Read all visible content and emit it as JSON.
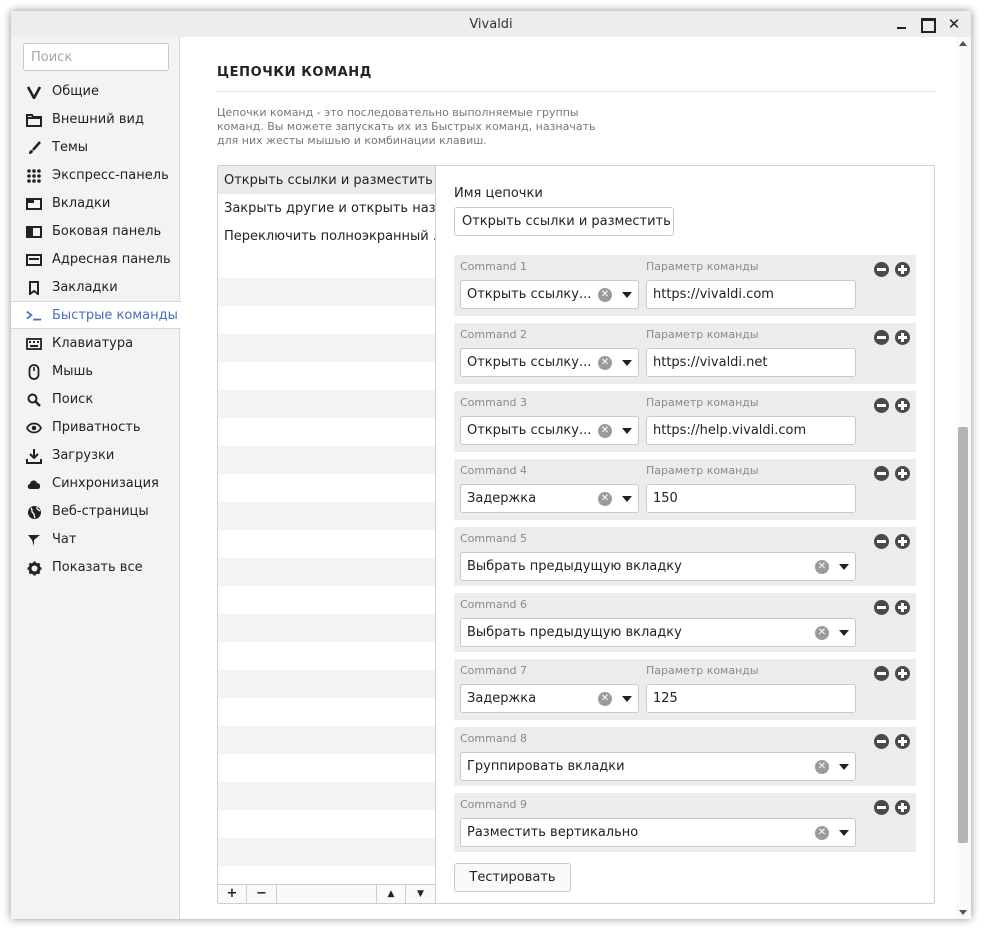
{
  "window": {
    "title": "Vivaldi"
  },
  "colors": {
    "accent": "#4a6fc0",
    "panel_bg": "#ececec",
    "sidebar_bg": "#f3f3f3"
  },
  "sidebar": {
    "search_placeholder": "Поиск",
    "items": [
      {
        "label": "Общие",
        "icon": "vivaldi-logo-icon"
      },
      {
        "label": "Внешний вид",
        "icon": "folder-icon"
      },
      {
        "label": "Темы",
        "icon": "brush-icon"
      },
      {
        "label": "Экспресс-панель",
        "icon": "grid-icon"
      },
      {
        "label": "Вкладки",
        "icon": "tabs-icon"
      },
      {
        "label": "Боковая панель",
        "icon": "side-panel-icon"
      },
      {
        "label": "Адресная панель",
        "icon": "address-bar-icon"
      },
      {
        "label": "Закладки",
        "icon": "bookmark-icon"
      },
      {
        "label": "Быстрые команды",
        "icon": "quick-commands-icon",
        "active": true
      },
      {
        "label": "Клавиатура",
        "icon": "keyboard-icon"
      },
      {
        "label": "Мышь",
        "icon": "mouse-icon"
      },
      {
        "label": "Поиск",
        "icon": "search-icon"
      },
      {
        "label": "Приватность",
        "icon": "eye-icon"
      },
      {
        "label": "Загрузки",
        "icon": "download-icon"
      },
      {
        "label": "Синхронизация",
        "icon": "cloud-icon"
      },
      {
        "label": "Веб-страницы",
        "icon": "globe-icon"
      },
      {
        "label": "Чат",
        "icon": "chat-icon"
      },
      {
        "label": "Показать все",
        "icon": "gear-icon"
      }
    ]
  },
  "main": {
    "title": "ЦЕПОЧКИ КОМАНД",
    "description": "Цепочки команд - это последовательно выполняемые группы команд. Вы можете запускать их из Быстрых команд, назначать для них жесты мышью и комбинации клавиш.",
    "chains": [
      "Открыть ссылки и разместить",
      "Закрыть другие и открыть наз...",
      "Переключить полноэкранный ..."
    ],
    "list_footer": {
      "add": "+",
      "remove": "−",
      "up": "▲",
      "down": "▼"
    },
    "editor": {
      "name_label": "Имя цепочки",
      "name_value": "Открыть ссылки и разместить",
      "param_label": "Параметр команды",
      "commands": [
        {
          "label": "Command 1",
          "value": "Открыть ссылку...",
          "param": "https://vivaldi.com"
        },
        {
          "label": "Command 2",
          "value": "Открыть ссылку...",
          "param": "https://vivaldi.net"
        },
        {
          "label": "Command 3",
          "value": "Открыть ссылку...",
          "param": "https://help.vivaldi.com"
        },
        {
          "label": "Command 4",
          "value": "Задержка",
          "param": "150"
        },
        {
          "label": "Command 5",
          "value": "Выбрать предыдущую вкладку"
        },
        {
          "label": "Command 6",
          "value": "Выбрать предыдущую вкладку"
        },
        {
          "label": "Command 7",
          "value": "Задержка",
          "param": "125"
        },
        {
          "label": "Command 8",
          "value": "Группировать вкладки"
        },
        {
          "label": "Command 9",
          "value": "Разместить вертикально"
        }
      ],
      "test_button": "Тестировать"
    }
  }
}
